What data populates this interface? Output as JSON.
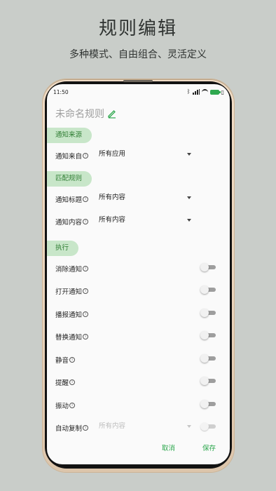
{
  "promo": {
    "title": "规则编辑",
    "subtitle": "多种模式、自由组合、灵活定义"
  },
  "status_bar": {
    "time": "11:50",
    "icons": [
      "bluetooth-icon",
      "signal-icon",
      "wifi-icon",
      "battery-icon",
      "vibrate-icon"
    ],
    "battery_color": "#2fa84f"
  },
  "rule": {
    "name_placeholder": "未命名规则"
  },
  "sections": {
    "source": {
      "tag": "通知来源",
      "rows": [
        {
          "label": "通知来自",
          "value": "所有应用"
        }
      ]
    },
    "match": {
      "tag": "匹配规则",
      "rows": [
        {
          "label": "通知标题",
          "value": "所有内容"
        },
        {
          "label": "通知内容",
          "value": "所有内容"
        }
      ]
    },
    "execute": {
      "tag": "执行",
      "rows": [
        {
          "label": "消除通知",
          "on": false
        },
        {
          "label": "打开通知",
          "on": false
        },
        {
          "label": "播报通知",
          "on": false
        },
        {
          "label": "替换通知",
          "on": false
        },
        {
          "label": "静音",
          "on": false
        },
        {
          "label": "提醒",
          "on": false
        },
        {
          "label": "振动",
          "on": false
        },
        {
          "label": "自动复制",
          "value": "所有内容",
          "on": false
        }
      ]
    }
  },
  "dialog": {
    "cancel_label": "取消",
    "save_label": "保存"
  },
  "colors": {
    "accent": "#2fa84f",
    "tag_background": "#c8e6c9",
    "tag_text": "#2e7d32",
    "page_background": "#c9cdc9"
  }
}
